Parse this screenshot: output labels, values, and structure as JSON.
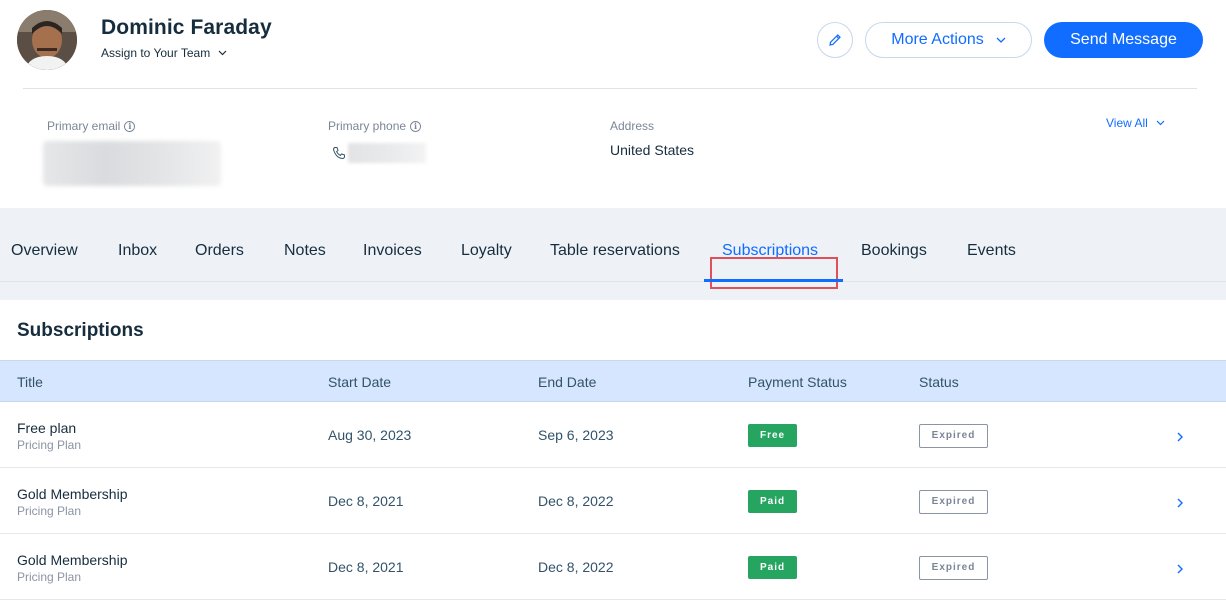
{
  "contact": {
    "name": "Dominic Faraday",
    "assign_label": "Assign to Your Team"
  },
  "actions": {
    "more_actions": "More Actions",
    "send_message": "Send Message"
  },
  "info": {
    "primary_email_label": "Primary email",
    "primary_phone_label": "Primary phone",
    "address_label": "Address",
    "address_value": "United States",
    "view_all": "View All"
  },
  "tabs": [
    {
      "label": "Overview",
      "active": false
    },
    {
      "label": "Inbox",
      "active": false
    },
    {
      "label": "Orders",
      "active": false
    },
    {
      "label": "Notes",
      "active": false
    },
    {
      "label": "Invoices",
      "active": false
    },
    {
      "label": "Loyalty",
      "active": false
    },
    {
      "label": "Table reservations",
      "active": false
    },
    {
      "label": "Subscriptions",
      "active": true
    },
    {
      "label": "Bookings",
      "active": false
    },
    {
      "label": "Events",
      "active": false
    }
  ],
  "subscriptions": {
    "title": "Subscriptions",
    "columns": [
      "Title",
      "Start Date",
      "End Date",
      "Payment Status",
      "Status"
    ],
    "rows": [
      {
        "title": "Free plan",
        "subtitle": "Pricing Plan",
        "start": "Aug 30, 2023",
        "end": "Sep 6, 2023",
        "payment": "Free",
        "status": "Expired"
      },
      {
        "title": "Gold Membership",
        "subtitle": "Pricing Plan",
        "start": "Dec 8, 2021",
        "end": "Dec 8, 2022",
        "payment": "Paid",
        "status": "Expired"
      },
      {
        "title": "Gold Membership",
        "subtitle": "Pricing Plan",
        "start": "Dec 8, 2021",
        "end": "Dec 8, 2022",
        "payment": "Paid",
        "status": "Expired"
      }
    ]
  },
  "colors": {
    "accent": "#116dff",
    "paid_badge": "#25a55f",
    "table_header": "#d6e6fe",
    "highlight_box": "#e0505a"
  },
  "icons": {
    "edit": "pencil-icon",
    "dropdown": "chevron-down-icon",
    "row_open": "chevron-right-icon",
    "info": "info-icon",
    "phone": "phone-icon"
  }
}
